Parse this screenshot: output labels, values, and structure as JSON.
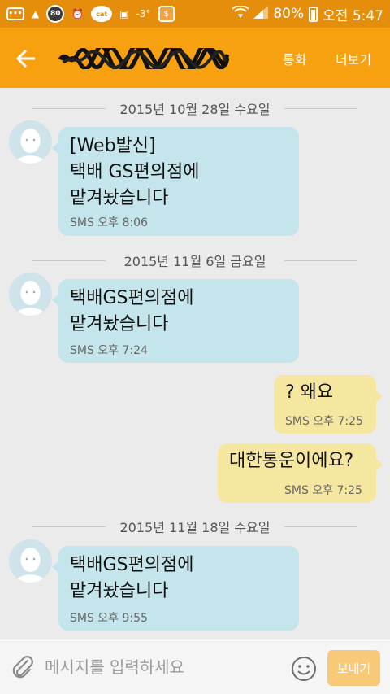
{
  "status_bar": {
    "icons": [
      "chat-icon",
      "weather-icon",
      "badge-80-icon",
      "alarm-icon",
      "cat-icon",
      "image-icon",
      "temperature-icon",
      "coin-icon"
    ],
    "badge_80": "80",
    "cat_label": "cat",
    "temperature": "-3°",
    "battery": "80%",
    "time": "오전 5:47",
    "wifi": "wifi-icon",
    "signal": "signal-icon"
  },
  "header": {
    "back_icon": "back-arrow-icon",
    "contact_name": "",
    "call_label": "통화",
    "more_label": "더보기"
  },
  "messages": [
    {
      "date": "2015년 10월 28일 수요일",
      "type": "in",
      "text": "[Web발신]\n택배 GS편의점에\n맡겨놨습니다",
      "meta": "SMS 오후 8:06"
    },
    {
      "date": "2015년 11월 6일 금요일",
      "type": "in",
      "text": "택배GS편의점에\n맡겨놨습니다",
      "meta": "SMS 오후 7:24"
    },
    {
      "type": "out",
      "text": "? 왜요",
      "meta": "SMS 오후 7:25"
    },
    {
      "type": "out",
      "text": "대한통운이에요?",
      "meta": "SMS 오후 7:25"
    },
    {
      "date": "2015년 11월 18일 수요일",
      "type": "in",
      "text": "택배GS편의점에\n맡겨놨습니다",
      "meta": "SMS 오후 9:55"
    }
  ],
  "composer": {
    "placeholder": "메시지를 입력하세요",
    "value": "",
    "send_label": "보내기",
    "attach_icon": "paperclip-icon",
    "emoji_icon": "emoji-icon"
  },
  "colors": {
    "status_bar": "#e48e0c",
    "app_bar": "#f7a010",
    "incoming_bubble": "#c4e5eb",
    "outgoing_bubble": "#f6e7a0",
    "send_button": "#f9c97a"
  }
}
